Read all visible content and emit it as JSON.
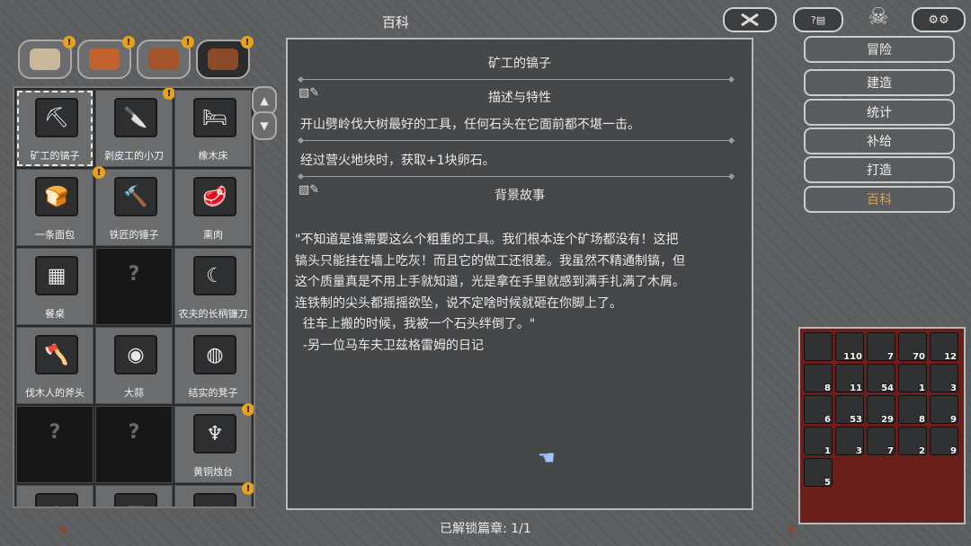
{
  "header": {
    "title": "百科"
  },
  "categories": [
    {
      "name": "map",
      "badge": "!"
    },
    {
      "name": "enemies",
      "badge": "!"
    },
    {
      "name": "resources",
      "badge": "!"
    },
    {
      "name": "items",
      "badge": "!"
    }
  ],
  "scroll": {
    "up": "▲",
    "down": "▼"
  },
  "grid": [
    {
      "label": "矿工的镐子",
      "icon": "⛏",
      "selected": true
    },
    {
      "label": "剥皮工的小刀",
      "icon": "🔪",
      "badge": "!"
    },
    {
      "label": "橡木床",
      "icon": "🛏"
    },
    {
      "label": "一条面包",
      "icon": "🍞"
    },
    {
      "label": "铁匠的锤子",
      "icon": "🔨",
      "badge": "!"
    },
    {
      "label": "熏肉",
      "icon": "🥩"
    },
    {
      "label": "餐桌",
      "icon": "▦"
    },
    {
      "label": "",
      "icon": "?"
    },
    {
      "label": "农夫的长柄镰刀",
      "icon": "☾"
    },
    {
      "label": "伐木人的斧头",
      "icon": "🪓"
    },
    {
      "label": "大蒜",
      "icon": "◉"
    },
    {
      "label": "结实的凳子",
      "icon": "◍"
    },
    {
      "label": "",
      "icon": "?"
    },
    {
      "label": "",
      "icon": "?"
    },
    {
      "label": "黄铜烛台",
      "icon": "♆",
      "badge": "!"
    },
    {
      "label": "",
      "icon": "○"
    },
    {
      "label": "",
      "icon": "▤"
    },
    {
      "label": "",
      "icon": "◌",
      "badge": "!"
    }
  ],
  "article": {
    "title": "矿工的镐子",
    "section1": "描述与特性",
    "line1": "开山劈岭伐大树最好的工具，任何石头在它面前都不堪一击。",
    "line2": "经过营火地块时，获取+1块卵石。",
    "section2": "背景故事",
    "story": "\"不知道是谁需要这么个粗重的工具。我们根本连个矿场都没有！这把\n镐头只能挂在墙上吃灰！而且它的做工还很差。我虽然不精通制镐，但\n这个质量真是不用上手就知道，光是拿在手里就感到满手扎满了木屑。\n连铁制的尖头都摇摇欲坠，说不定啥时候就砸在你脚上了。\n  往车上搬的时候，我被一个石头绊倒了。\"\n  -另一位马车夫卫兹格雷姆的日记"
  },
  "footer": "已解锁篇章: 1/1",
  "menu": [
    "冒险",
    "建造",
    "统计",
    "补给",
    "打造",
    "百科"
  ],
  "active_menu": "百科",
  "inventory": [
    "",
    "110",
    "7",
    "70",
    "12",
    "8",
    "11",
    "54",
    "1",
    "3",
    "6",
    "53",
    "29",
    "8",
    "9",
    "1",
    "3",
    "7",
    "2",
    "9",
    "5"
  ]
}
